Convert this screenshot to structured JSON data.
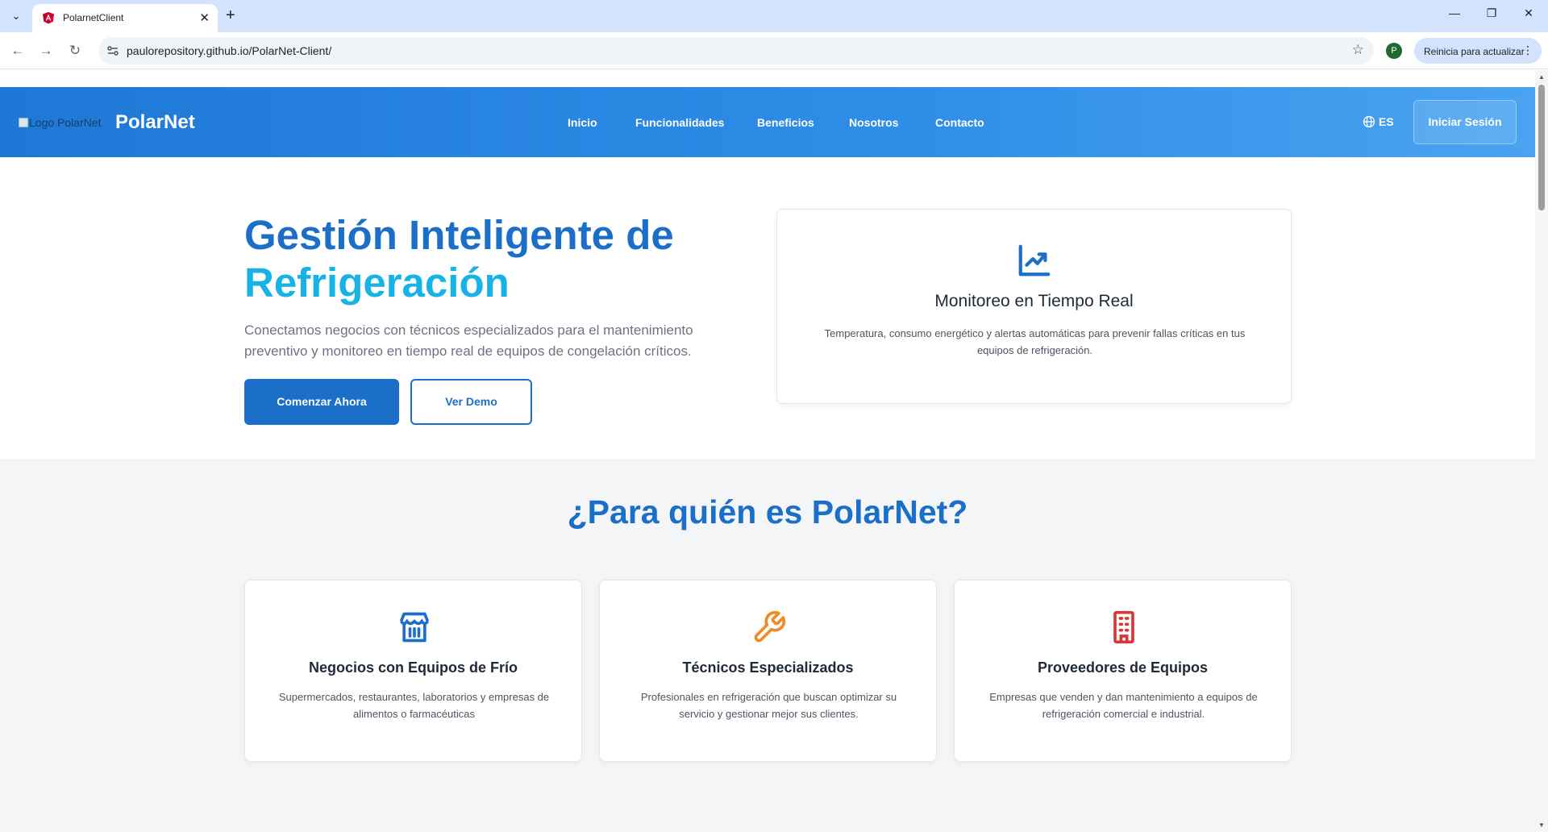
{
  "browser": {
    "tab_title": "PolarnetClient",
    "url": "paulorepository.github.io/PolarNet-Client/",
    "profile_initial": "P",
    "update_label": "Reinicia para actualizar"
  },
  "header": {
    "logo_alt": "Logo PolarNet",
    "brand": "PolarNet",
    "nav": [
      "Inicio",
      "Funcionalidades",
      "Beneficios",
      "Nosotros",
      "Contacto"
    ],
    "language": "ES",
    "login_label": "Iniciar Sesión"
  },
  "hero": {
    "title_line1": "Gestión Inteligente de",
    "title_line2": "Refrigeración",
    "subtitle": "Conectamos negocios con técnicos especializados para el mantenimiento preventivo y monitoreo en tiempo real de equipos de congelación críticos.",
    "primary_button": "Comenzar Ahora",
    "secondary_button": "Ver Demo",
    "card": {
      "icon": "trending-up-icon",
      "title": "Monitoreo en Tiempo Real",
      "text": "Temperatura, consumo energético y alertas automáticas para prevenir fallas críticas en tus equipos de refrigeración."
    }
  },
  "audience": {
    "title": "¿Para quién es PolarNet?",
    "cards": [
      {
        "icon": "store-icon",
        "color": "#1b6fc9",
        "title": "Negocios con Equipos de Frío",
        "text": "Supermercados, restaurantes, laboratorios y empresas de alimentos o farmacéuticas"
      },
      {
        "icon": "wrench-icon",
        "color": "#f08a24",
        "title": "Técnicos Especializados",
        "text": "Profesionales en refrigeración que buscan optimizar su servicio y gestionar mejor sus clientes."
      },
      {
        "icon": "building-icon",
        "color": "#d93636",
        "title": "Proveedores de Equipos",
        "text": "Empresas que venden y dan mantenimiento a equipos de refrigeración comercial e industrial."
      }
    ]
  },
  "colors": {
    "primary": "#1b6fc9",
    "accent": "#17b2e6",
    "header_start": "#1e78d6",
    "header_end": "#4aa3f0"
  }
}
